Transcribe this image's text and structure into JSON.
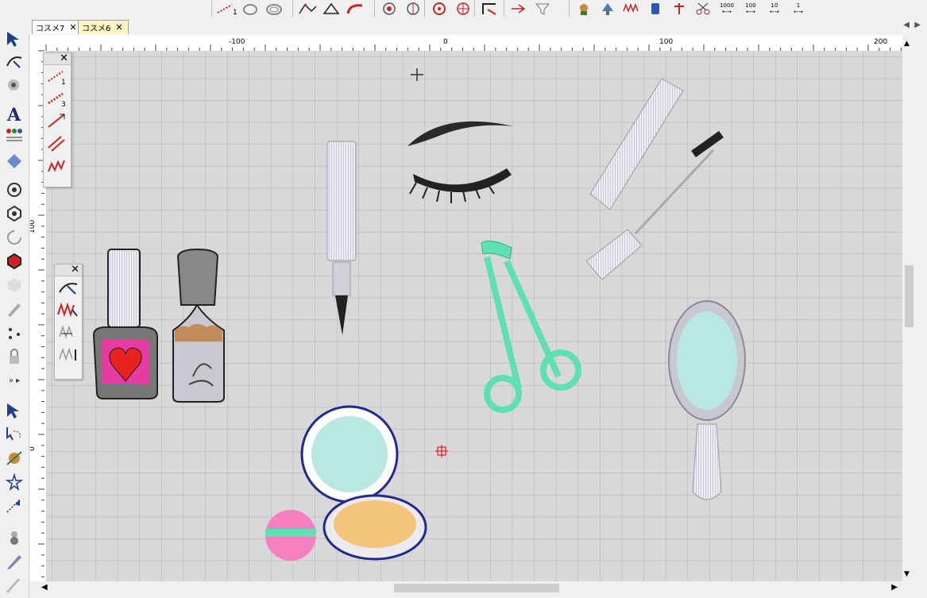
{
  "tabs": [
    {
      "label": "コスメ7",
      "active": false
    },
    {
      "label": "コスメ6",
      "active": true
    }
  ],
  "ruler": {
    "h_labels": [
      "-100",
      "0",
      "100",
      "200"
    ],
    "v_labels": [
      "100",
      "0"
    ]
  },
  "toolbar_icons": [
    "line-stitch-icon",
    "ring-icon",
    "node-edit-icon",
    "curve-icon",
    "spiral-icon",
    "circle-fill-icon",
    "border-icon",
    "arrow-icon",
    "filter-icon",
    "thread-color-icon"
  ],
  "toolbar_right_labels": [
    "1000",
    "100",
    "10",
    "1"
  ],
  "left_tools": [
    "select-arrow-icon",
    "reshape-icon",
    "applique-icon",
    "text-tool-icon",
    "people-icon",
    "badge-icon",
    "target-circle-icon",
    "hex-outline-icon",
    "spiral-outline-icon",
    "hex-red-icon",
    "hex-gray-icon",
    "pencil-icon",
    "dots-icon",
    "lock-icon",
    "more-icon",
    "select-icon",
    "lasso-icon",
    "fill-icon",
    "star-select-icon",
    "point-select-icon",
    "bottle-icon",
    "pen-icon",
    "brush-icon"
  ],
  "panel1": {
    "items": [
      "1",
      "3"
    ]
  },
  "colors": {
    "pink": "#e63ba1",
    "heart": "#e8231f",
    "mint": "#5fe0b0",
    "tan": "#c08c5a",
    "navy": "#1f2a8c"
  }
}
